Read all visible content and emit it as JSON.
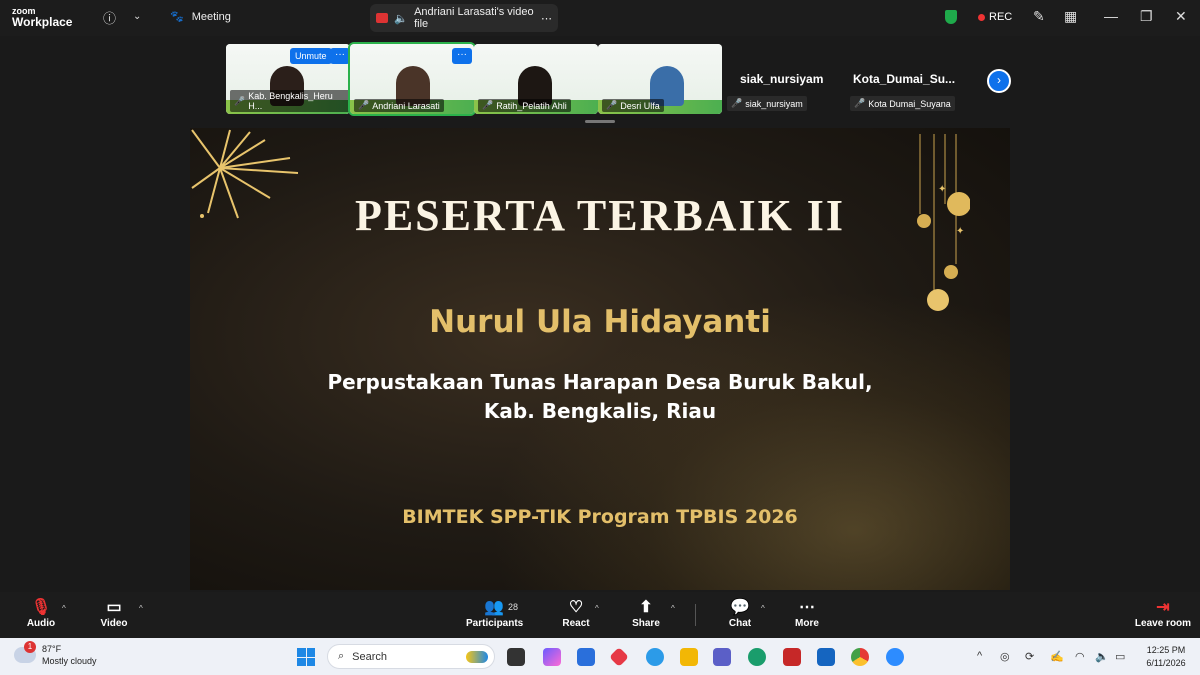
{
  "titlebar": {
    "logo_top": "zoom",
    "logo_bottom": "Workplace",
    "meeting_label": "Meeting",
    "share_label": "Andriani Larasati's video file",
    "rec_label": "REC"
  },
  "strip": {
    "thumbs": [
      {
        "name": "Kab. Bengkalis_Heru H...",
        "unmute": "Unmute",
        "more": "···"
      },
      {
        "name": "Andriani Larasati",
        "more": "···"
      },
      {
        "name": "Ratih_Pelatih Ahli"
      },
      {
        "name": "Desri Ulfa"
      }
    ],
    "text_tiles": [
      {
        "title": "siak_nursiyam",
        "sub": "siak_nursiyam"
      },
      {
        "title": "Kota_Dumai_Su...",
        "sub": "Kota Dumai_Suyana"
      }
    ]
  },
  "slide": {
    "title": "PESERTA TERBAIK II",
    "name": "Nurul Ula Hidayanti",
    "org_line1": "Perpustakaan Tunas Harapan Desa Buruk Bakul,",
    "org_line2": "Kab. Bengkalis, Riau",
    "footer": "BIMTEK SPP-TIK Program TPBIS 2026"
  },
  "controls": {
    "audio": "Audio",
    "video": "Video",
    "participants": "Participants",
    "participants_count": "28",
    "react": "React",
    "share": "Share",
    "chat": "Chat",
    "more": "More",
    "leave": "Leave room"
  },
  "taskbar": {
    "weather_badge": "1",
    "temp": "87°F",
    "condition": "Mostly cloudy",
    "search_placeholder": "Search",
    "time": "12:25 PM",
    "date": "6/11/2026"
  },
  "colors": {
    "accent_blue": "#0e71eb",
    "gold": "#e3bf6a",
    "active_green": "#2bb14b",
    "rec_red": "#e33333"
  }
}
